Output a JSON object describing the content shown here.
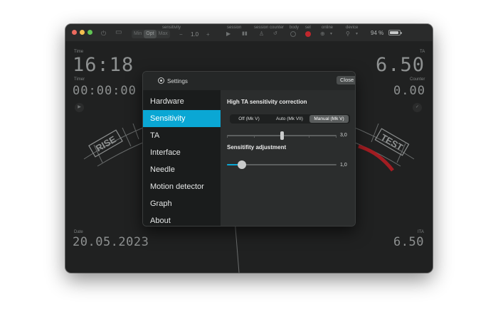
{
  "toolbar": {
    "sensitivity_label": "sensitivity",
    "sensitivity_options": [
      "Min",
      "Opt",
      "Max"
    ],
    "sensitivity_selected": "Opt",
    "minus": "−",
    "sensitivity_value": "1.0",
    "plus": "+",
    "session_label": "session",
    "session_counter_label": "session counter",
    "body_label": "body",
    "sel_label": "sel",
    "online_label": "online",
    "device_label": "device",
    "battery": "94 %",
    "accent_red": "#c0272d"
  },
  "dashboard": {
    "time_label": "Time",
    "time_value": "16:18",
    "ta_label": "TA",
    "ta_value": "6.50",
    "timer_label": "Timer",
    "timer_value": "00:00:00",
    "counter_label": "Counter",
    "counter_value": "0.00",
    "gauge_left": "RISE",
    "gauge_right": "TEST",
    "date_label": "Date",
    "date_value": "20.05.2023",
    "ita_label": "ITA",
    "ita_value": "6.50"
  },
  "dialog": {
    "title": "Settings",
    "close": "Close",
    "menu": [
      "Hardware",
      "Sensitivity",
      "TA",
      "Interface",
      "Needle",
      "Motion detector",
      "Graph",
      "About"
    ],
    "selected_menu": "Sensitivity",
    "accent": "#0aa7d4",
    "section1_title": "High TA sensitivity correction",
    "modes": [
      "Off (Mk V)",
      "Auto (Mk VII)",
      "Manual (Mk V)"
    ],
    "selected_mode": "Manual (Mk V)",
    "correction_value": "3,0",
    "correction_fraction": 0.5,
    "section2_title": "Sensitifity adjustment",
    "adjustment_value": "1,0",
    "adjustment_fraction": 0.1
  }
}
